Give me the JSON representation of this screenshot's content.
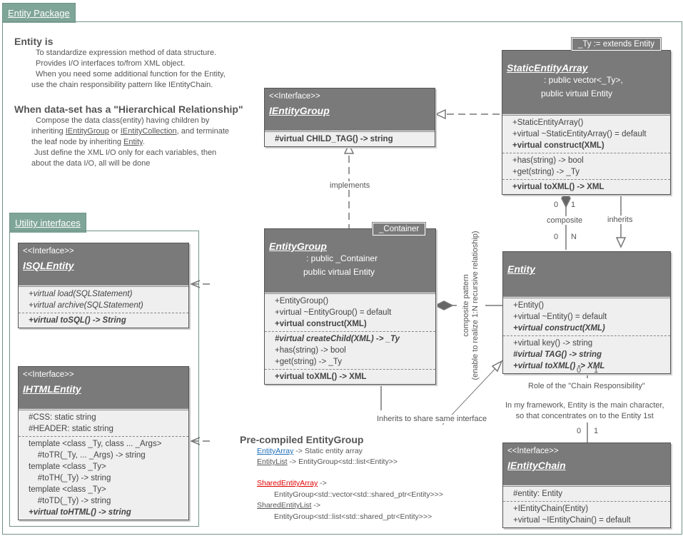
{
  "packages": {
    "entity": "Entity Package",
    "utility": "Utility interfaces"
  },
  "notes": {
    "entity_is": {
      "title": "Entity is",
      "lines": [
        "To standardize expression method of data structure.",
        "Provides I/O interfaces to/from XML object.",
        "When you need some additional function for the Entity,",
        "use the chain responsibility pattern like IEntityChain."
      ]
    },
    "hierarchy": {
      "title": "When data-set has a \"Hierarchical Relationship\"",
      "l1": "Compose the data class(entity) having children by",
      "l2a": "inheriting ",
      "link1": "IEntityGroup",
      "l2b": " or ",
      "link2": "IEntityCollection",
      "l2c": ", and  terminate",
      "l3a": "the leaf node by inheriting ",
      "link3": "Entity",
      "l3b": ".",
      "l4": "Just define the XML I/O only for each variables, then",
      "l5": "about the data I/O, all will be done"
    },
    "precompiled": {
      "title": "Pre-compiled EntityGroup",
      "items": [
        {
          "name": "EntityArray",
          "desc": " -> Static entity array",
          "color": "#1f6fb8"
        },
        {
          "name": "EntityList",
          "desc": " -> EntityGroup<std::list<Entity>>",
          "color": "#555555"
        },
        {
          "name": "SharedEntityArray",
          "desc": " ->",
          "desc2": "EntityGroup<std::vector<std::shared_ptr<Entity>>>",
          "color": "#e00000"
        },
        {
          "name": "SharedEntityList",
          "desc": " ->",
          "desc2": "EntityGroup<std::list<std::shared_ptr<Entity>>>",
          "color": "#555555"
        }
      ]
    }
  },
  "classes": {
    "IEntityGroup": {
      "stereotype": "<<Interface>>",
      "name": "IEntityGroup",
      "sections": [
        [
          {
            "t": "#virtual CHILD_TAG() -> string",
            "s": "b"
          }
        ]
      ]
    },
    "StaticEntityArray": {
      "tag": "_Ty := extends Entity",
      "name": "StaticEntityArray",
      "extends": [
        ": public vector<_Ty>,",
        "public virtual Entity"
      ],
      "sections": [
        [
          {
            "t": "+StaticEntityArray()"
          },
          {
            "t": "+virtual ~StaticEntityArray() = default"
          },
          {
            "t": "+virtual construct(XML)",
            "s": "b"
          }
        ],
        [
          {
            "t": "+has(string) -> bool"
          },
          {
            "t": "+get(string) -> _Ty"
          }
        ],
        [
          {
            "t": "+virtual toXML() -> XML",
            "s": "b"
          }
        ]
      ]
    },
    "EntityGroup": {
      "tag": "_Container",
      "name": "EntityGroup",
      "extends": [
        ": public _Container",
        "public virtual Entity"
      ],
      "sections": [
        [
          {
            "t": "+EntityGroup()"
          },
          {
            "t": "+virtual ~EntityGroup() = default"
          },
          {
            "t": "+virtual construct(XML)",
            "s": "b"
          }
        ],
        [
          {
            "t": "#virtual createChild(XML) -> _Ty",
            "s": "bi"
          },
          {
            "t": "+has(string) -> bool"
          },
          {
            "t": "+get(string) -> _Ty"
          }
        ],
        [
          {
            "t": "+virtual toXML() -> XML",
            "s": "b"
          }
        ]
      ]
    },
    "Entity": {
      "name": "Entity",
      "sections": [
        [
          {
            "t": "+Entity()"
          },
          {
            "t": "+virtual ~Entity() = default"
          },
          {
            "t": "+virtual construct(XML)",
            "s": "bi"
          }
        ],
        [
          {
            "t": "+virtual key() -> string"
          },
          {
            "t": "#virtual TAG() -> string",
            "s": "bi"
          },
          {
            "t": "+virtual toXML() -> XML",
            "s": "bi"
          }
        ]
      ]
    },
    "ISQLEntity": {
      "stereotype": "<<Interface>>",
      "name": "ISQLEntity",
      "sections": [
        [
          {
            "t": "+virtual load(SQLStatement)",
            "s": "i"
          },
          {
            "t": "+virtual archive(SQLStatement)",
            "s": "i"
          }
        ],
        [
          {
            "t": "+virtual toSQL() -> String",
            "s": "bi"
          }
        ]
      ]
    },
    "IHTMLEntity": {
      "stereotype": "<<Interface>>",
      "name": "IHTMLEntity",
      "sections": [
        [
          {
            "t": "#CSS: static string"
          },
          {
            "t": "#HEADER: static string"
          }
        ],
        [
          {
            "t": "template <class _Ty, class ... _Args>"
          },
          {
            "t": "    #toTR(_Ty, ... _Args) -> string"
          },
          {
            "t": "template <class _Ty>"
          },
          {
            "t": "    #toTH(_Ty) -> string"
          },
          {
            "t": "template <class _Ty>"
          },
          {
            "t": "    #toTD(_Ty) -> string"
          },
          {
            "t": "+virtual toHTML() -> string",
            "s": "bi"
          }
        ]
      ]
    },
    "IEntityChain": {
      "stereotype": "<<Interface>>",
      "name": "IEntityChain",
      "sections": [
        [
          {
            "t": "#entity: Entity"
          }
        ],
        [
          {
            "t": "+IEntityChain(Entity)"
          },
          {
            "t": "+virtual ~IEntityChain() = default"
          }
        ]
      ]
    }
  },
  "labels": {
    "implements": "implements",
    "composite": "composite",
    "inherits": "inherits",
    "composite_pattern": "composite pattern",
    "composite_pattern2": "(enable to realize 1:N recursive relatioship)",
    "inherits_share": "Inherits to share same interface",
    "chain_role": "Role of the \"Chain Responsibility\"",
    "framework1": "In my framework, Entity is the main character,",
    "framework2": "so that concentrates on to the Entity 1st",
    "m0": "0",
    "m1": "1",
    "mN": "N"
  }
}
